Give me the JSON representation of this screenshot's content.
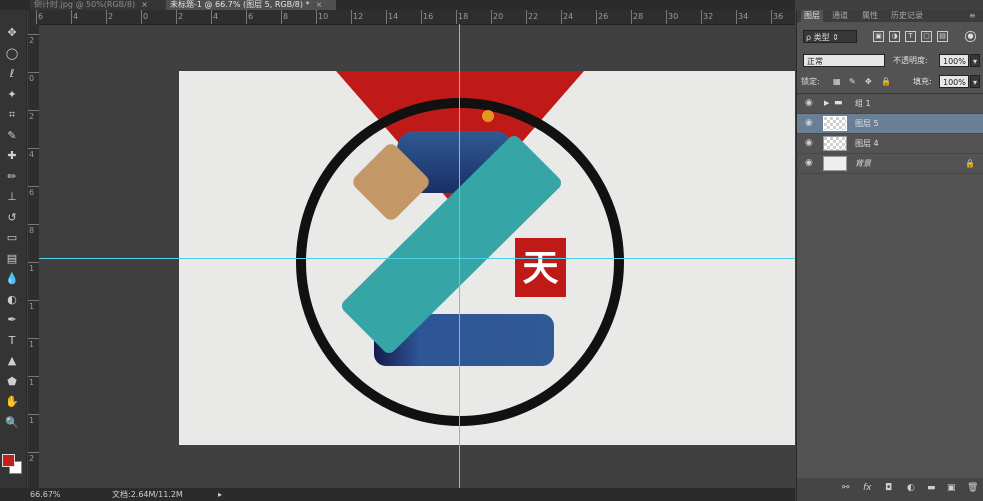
{
  "tabs": [
    {
      "label": "倒计时.jpg @ 50%(RGB/8)",
      "close": "×"
    },
    {
      "label": "未标题-1 @ 66.7% (图层 5, RGB/8) *",
      "close": "×"
    }
  ],
  "ruler": {
    "top_labels": [
      "6",
      "4",
      "2",
      "0",
      "2",
      "4",
      "6",
      "8",
      "10",
      "12",
      "14",
      "16",
      "18",
      "20",
      "22",
      "24",
      "26",
      "28",
      "30",
      "32",
      "34",
      "36"
    ],
    "left_labels": [
      "2",
      "0",
      "2",
      "4",
      "6",
      "8",
      "1",
      "1",
      "1",
      "1",
      "1",
      "2"
    ]
  },
  "toolbar": {
    "tools": [
      {
        "name": "move-tool",
        "glyph": "✥"
      },
      {
        "name": "marquee-tool",
        "glyph": "◯"
      },
      {
        "name": "lasso-tool",
        "glyph": "ℓ"
      },
      {
        "name": "magic-wand-tool",
        "glyph": "✦"
      },
      {
        "name": "crop-tool",
        "glyph": "⌗"
      },
      {
        "name": "eyedropper-tool",
        "glyph": "✎"
      },
      {
        "name": "healing-tool",
        "glyph": "✚"
      },
      {
        "name": "brush-tool",
        "glyph": "✏"
      },
      {
        "name": "stamp-tool",
        "glyph": "⊥"
      },
      {
        "name": "history-brush-tool",
        "glyph": "↺"
      },
      {
        "name": "eraser-tool",
        "glyph": "▭"
      },
      {
        "name": "gradient-tool",
        "glyph": "▤"
      },
      {
        "name": "blur-tool",
        "glyph": "💧"
      },
      {
        "name": "dodge-tool",
        "glyph": "◐"
      },
      {
        "name": "pen-tool",
        "glyph": "✒"
      },
      {
        "name": "type-tool",
        "glyph": "T"
      },
      {
        "name": "path-selection-tool",
        "glyph": "▲"
      },
      {
        "name": "shape-tool",
        "glyph": "⬟"
      },
      {
        "name": "hand-tool",
        "glyph": "✋"
      },
      {
        "name": "zoom-tool",
        "glyph": "🔍"
      }
    ],
    "colors": {
      "foreground": "#c6201c",
      "background": "#ffffff"
    }
  },
  "status": {
    "zoom": "66.67%",
    "doc": "文档:2.64M/11.2M",
    "arrow": "▸"
  },
  "logo": {
    "char": "天"
  },
  "panel": {
    "tabs": [
      "图层",
      "通道",
      "属性",
      "历史记录"
    ],
    "filter_label": "ρ 类型",
    "blend_mode": "正常",
    "opacity_label": "不透明度:",
    "opacity_value": "100%",
    "lock_label": "锁定:",
    "fill_label": "填充:",
    "fill_value": "100%",
    "layers": [
      {
        "name": "组 1",
        "type": "group"
      },
      {
        "name": "图层 5",
        "type": "layer",
        "selected": true
      },
      {
        "name": "图层 4",
        "type": "layer"
      },
      {
        "name": "背景",
        "type": "background"
      }
    ],
    "footer_icons": [
      "link-icon",
      "fx-icon",
      "mask-icon",
      "adjustment-icon",
      "folder-icon",
      "new-layer-icon",
      "trash-icon"
    ]
  }
}
